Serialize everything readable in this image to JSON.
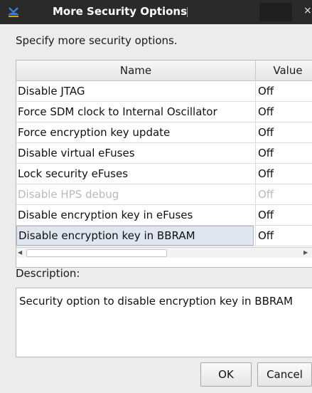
{
  "window": {
    "title": "More Security Options",
    "close_glyph": "×"
  },
  "prompt": "Specify more security options.",
  "table": {
    "headers": {
      "name": "Name",
      "value": "Value"
    },
    "rows": [
      {
        "name": "Disable JTAG",
        "value": "Off",
        "enabled": true,
        "selected": false
      },
      {
        "name": "Force SDM clock to Internal Oscillator",
        "value": "Off",
        "enabled": true,
        "selected": false
      },
      {
        "name": "Force encryption key update",
        "value": "Off",
        "enabled": true,
        "selected": false
      },
      {
        "name": "Disable virtual eFuses",
        "value": "Off",
        "enabled": true,
        "selected": false
      },
      {
        "name": "Lock security eFuses",
        "value": "Off",
        "enabled": true,
        "selected": false
      },
      {
        "name": "Disable HPS debug",
        "value": "Off",
        "enabled": false,
        "selected": false
      },
      {
        "name": "Disable encryption key in eFuses",
        "value": "Off",
        "enabled": true,
        "selected": false
      },
      {
        "name": "Disable encryption key in BBRAM",
        "value": "Off",
        "enabled": true,
        "selected": true
      }
    ]
  },
  "description": {
    "label": "Description:",
    "text": "Security option to disable encryption key in BBRAM"
  },
  "buttons": {
    "ok": "OK",
    "cancel": "Cancel"
  },
  "icons": {
    "app": "app-logo-icon",
    "close": "close-icon",
    "scroll_left": "scroll-left-arrow-icon",
    "scroll_right": "scroll-right-arrow-icon"
  },
  "colors": {
    "titlebar": "#2a2a2a",
    "selection": "#dfe6ef",
    "disabled_text": "#b9b9b9"
  }
}
